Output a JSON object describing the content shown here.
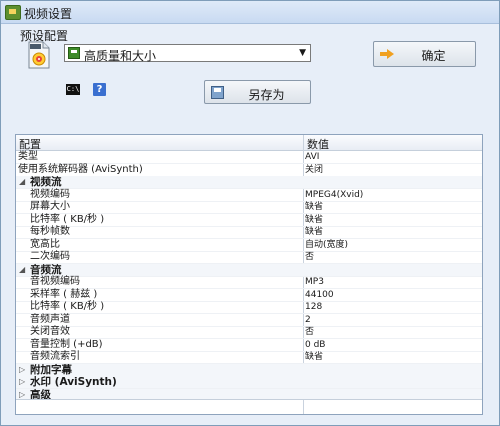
{
  "window": {
    "title": "视频设置"
  },
  "preset": {
    "label": "预设配置",
    "selected": "高质量和大小"
  },
  "buttons": {
    "ok": "确定",
    "save_as": "另存为"
  },
  "grid": {
    "headers": {
      "name": "配置",
      "value": "数值"
    },
    "rows": [
      {
        "name": "类型",
        "value": "AVI",
        "indent": 0
      },
      {
        "name": "使用系统解码器 (AviSynth)",
        "value": "关闭",
        "indent": 0
      },
      {
        "name": "视频流",
        "value": "",
        "group": true,
        "expander": "◢"
      },
      {
        "name": "视频编码",
        "value": "MPEG4(Xvid)",
        "indent": 1
      },
      {
        "name": "屏幕大小",
        "value": "缺省",
        "indent": 1
      },
      {
        "name": "比特率 ( KB/秒 )",
        "value": "缺省",
        "indent": 1
      },
      {
        "name": "每秒帧数",
        "value": "缺省",
        "indent": 1
      },
      {
        "name": "宽高比",
        "value": "自动(宽度)",
        "indent": 1
      },
      {
        "name": "二次编码",
        "value": "否",
        "indent": 1
      },
      {
        "name": "音频流",
        "value": "",
        "group": true,
        "expander": "◢"
      },
      {
        "name": "音视频编码",
        "value": "MP3",
        "indent": 1
      },
      {
        "name": "采样率 ( 赫兹 )",
        "value": "44100",
        "indent": 1
      },
      {
        "name": "比特率 ( KB/秒 )",
        "value": "128",
        "indent": 1
      },
      {
        "name": "音频声道",
        "value": "2",
        "indent": 1
      },
      {
        "name": "关闭音效",
        "value": "否",
        "indent": 1
      },
      {
        "name": "音量控制 (+dB)",
        "value": "0 dB",
        "indent": 1
      },
      {
        "name": "音频流索引",
        "value": "缺省",
        "indent": 1
      },
      {
        "name": "附加字幕",
        "value": "",
        "group": true,
        "expander": "▷"
      },
      {
        "name": "水印 (AviSynth)",
        "value": "",
        "group": true,
        "expander": "▷"
      },
      {
        "name": "高级",
        "value": "",
        "group": true,
        "expander": "▷"
      }
    ]
  },
  "icons": {
    "app": "video-settings-icon",
    "preset_file": "avi-file-icon",
    "select": "save-disk-icon",
    "ok": "arrow-right-icon",
    "save_as": "floppy-disk-icon",
    "console": "command-prompt-icon",
    "help": "help-icon"
  },
  "colors": {
    "window_bg": "#e7eef8",
    "titlebar": "#c8daf2",
    "grid_bg": "#ffffff"
  }
}
